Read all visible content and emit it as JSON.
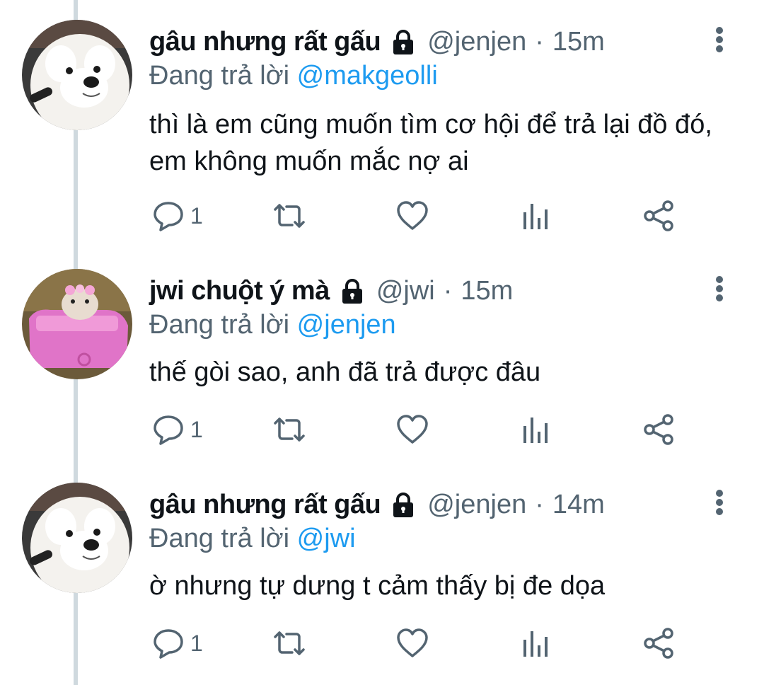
{
  "tweets": [
    {
      "name": "gâu nhưng rất gấu",
      "handle": "@jenjen",
      "separator": "·",
      "time": "15m",
      "reply_prefix": "Đang trả lời",
      "reply_to": "@makgeolli",
      "text": "thì là em cũng muốn tìm cơ hội để trả lại đồ đó, em không muốn mắc nợ ai",
      "reply_count": "1",
      "avatar": "white-dog"
    },
    {
      "name": "jwi chuột ý mà",
      "handle": "@jwi",
      "separator": "·",
      "time": "15m",
      "reply_prefix": "Đang trả lời",
      "reply_to": "@jenjen",
      "text": "thế gòi sao, anh đã trả được đâu",
      "reply_count": "1",
      "avatar": "hamster-pink-car"
    },
    {
      "name": "gâu nhưng rất gấu",
      "handle": "@jenjen",
      "separator": "·",
      "time": "14m",
      "reply_prefix": "Đang trả lời",
      "reply_to": "@jwi",
      "text": "ờ nhưng tự dưng t cảm thấy bị đe dọa",
      "reply_count": "1",
      "avatar": "white-dog"
    }
  ],
  "colors": {
    "text_primary": "#0f1419",
    "text_secondary": "#536471",
    "mention": "#1d9bf0",
    "thread_line": "#cfd9de"
  },
  "icons": [
    "lock-icon",
    "more-icon",
    "reply-icon",
    "retweet-icon",
    "like-icon",
    "views-icon",
    "share-icon"
  ]
}
